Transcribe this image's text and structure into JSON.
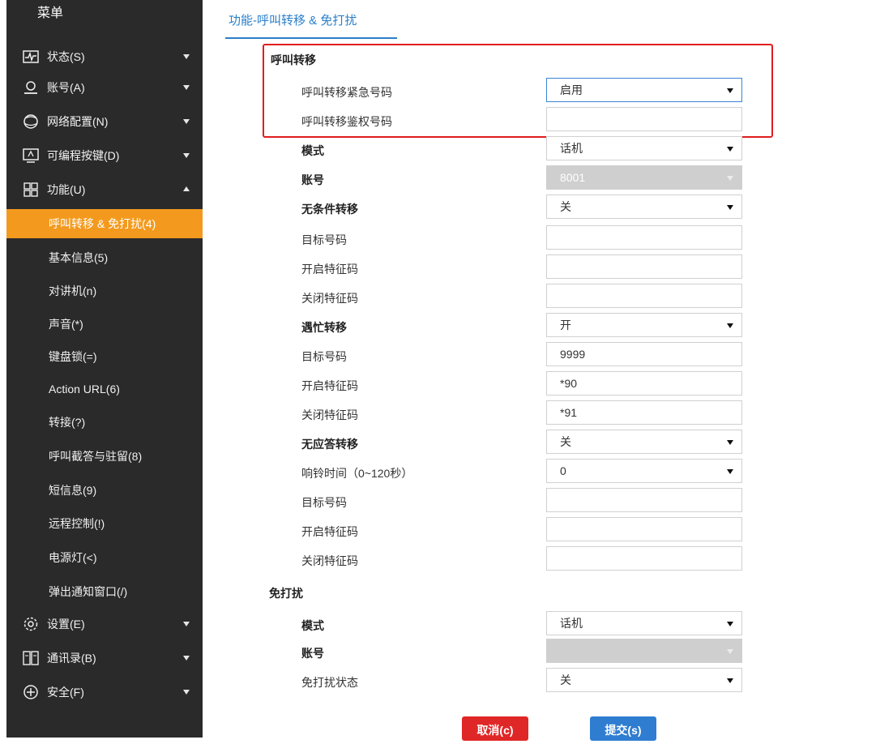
{
  "sidebar": {
    "title": "菜单",
    "items": [
      {
        "label": "状态(S)",
        "icon": "status-icon"
      },
      {
        "label": "账号(A)",
        "icon": "account-icon"
      },
      {
        "label": "网络配置(N)",
        "icon": "network-icon"
      },
      {
        "label": "可编程按键(D)",
        "icon": "dsskey-icon"
      },
      {
        "label": "功能(U)",
        "icon": "features-icon"
      },
      {
        "label": "设置(E)",
        "icon": "settings-icon"
      },
      {
        "label": "通讯录(B)",
        "icon": "directory-icon"
      },
      {
        "label": "安全(F)",
        "icon": "security-icon"
      }
    ],
    "sub_items": [
      {
        "label": "呼叫转移 & 免打扰(4)",
        "active": true
      },
      {
        "label": "基本信息(5)"
      },
      {
        "label": "对讲机(n)"
      },
      {
        "label": "声音(*)"
      },
      {
        "label": "键盘锁(=)"
      },
      {
        "label": "Action URL(6)"
      },
      {
        "label": "转接(?)"
      },
      {
        "label": "呼叫截答与驻留(8)"
      },
      {
        "label": "短信息(9)"
      },
      {
        "label": "远程控制(!)"
      },
      {
        "label": "电源灯(<)"
      },
      {
        "label": "弹出通知窗口(/)"
      }
    ]
  },
  "page": {
    "title": "功能-呼叫转移 & 免打扰"
  },
  "call_forward": {
    "section_title": "呼叫转移",
    "emergency_label": "呼叫转移紧急号码",
    "emergency_value": "启用",
    "auth_label": "呼叫转移鉴权号码",
    "auth_value": "",
    "mode_label": "模式",
    "mode_value": "话机",
    "account_label": "账号",
    "account_value": "8001",
    "always": {
      "label": "无条件转移",
      "value": "关",
      "target_label": "目标号码",
      "target_value": "",
      "on_code_label": "开启特征码",
      "on_code_value": "",
      "off_code_label": "关闭特征码",
      "off_code_value": ""
    },
    "busy": {
      "label": "遇忙转移",
      "value": "开",
      "target_label": "目标号码",
      "target_value": "9999",
      "on_code_label": "开启特征码",
      "on_code_value": "*90",
      "off_code_label": "关闭特征码",
      "off_code_value": "*91"
    },
    "no_answer": {
      "label": "无应答转移",
      "value": "关",
      "ring_time_label": "响铃时间（0~120秒）",
      "ring_time_value": "0",
      "target_label": "目标号码",
      "target_value": "",
      "on_code_label": "开启特征码",
      "on_code_value": "",
      "off_code_label": "关闭特征码",
      "off_code_value": ""
    }
  },
  "dnd": {
    "section_title": "免打扰",
    "mode_label": "模式",
    "mode_value": "话机",
    "account_label": "账号",
    "account_value": "",
    "status_label": "免打扰状态",
    "status_value": "关"
  },
  "buttons": {
    "cancel": "取消(c)",
    "submit": "提交(s)"
  },
  "colors": {
    "sidebar_bg": "#2a2a2a",
    "active_bg": "#f39a1e",
    "title_blue": "#2a7fc9",
    "highlight_red": "#e21d1d",
    "cancel_red": "#e02727",
    "submit_blue": "#2f7dd0"
  }
}
